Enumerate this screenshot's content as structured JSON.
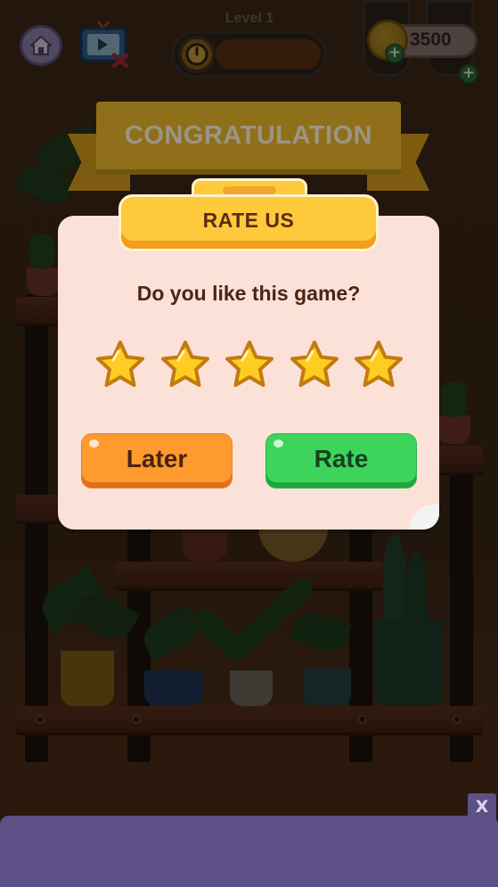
{
  "hud": {
    "level_label": "Level 1",
    "coins": "3500",
    "icons": [
      "home-icon",
      "tv-ad-icon",
      "clock-icon",
      "coin-icon",
      "plus-icon"
    ]
  },
  "banner": {
    "title": "CONGRATULATION"
  },
  "dialog": {
    "title": "RATE US",
    "question": "Do you like this game?",
    "stars": {
      "count": 5,
      "filled": 5
    },
    "later_label": "Later",
    "rate_label": "Rate"
  },
  "ad": {
    "close_label": "X"
  },
  "colors": {
    "dialog_bg": "#fbe1d7",
    "header_yellow": "#ffc93c",
    "later_orange": "#ff9a2e",
    "rate_green": "#3ed45c",
    "star_gold": "#ffcd21",
    "ad_purple": "#5c5087"
  }
}
